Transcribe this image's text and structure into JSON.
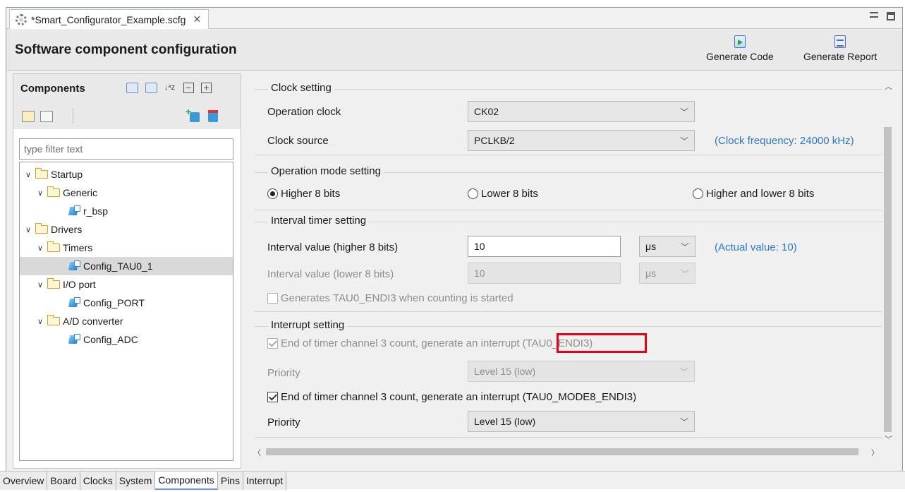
{
  "editor_tab": {
    "title": "*Smart_Configurator_Example.scfg",
    "close": "✕"
  },
  "header": {
    "title": "Software component configuration",
    "generate_code": "Generate Code",
    "generate_report": "Generate Report"
  },
  "components": {
    "title": "Components",
    "filter_placeholder": "type filter text",
    "tree": [
      {
        "label": "Startup",
        "kind": "folder",
        "level": 0
      },
      {
        "label": "Generic",
        "kind": "folder",
        "level": 1
      },
      {
        "label": "r_bsp",
        "kind": "component",
        "level": 2
      },
      {
        "label": "Drivers",
        "kind": "folder",
        "level": 0
      },
      {
        "label": "Timers",
        "kind": "folder",
        "level": 1
      },
      {
        "label": "Config_TAU0_1",
        "kind": "component",
        "level": 2,
        "selected": true
      },
      {
        "label": "I/O port",
        "kind": "folder",
        "level": 1
      },
      {
        "label": "Config_PORT",
        "kind": "component",
        "level": 2
      },
      {
        "label": "A/D converter",
        "kind": "folder",
        "level": 1
      },
      {
        "label": "Config_ADC",
        "kind": "component",
        "level": 2
      }
    ]
  },
  "clock": {
    "title": "Clock setting",
    "operation_clock_label": "Operation clock",
    "operation_clock_value": "CK02",
    "clock_source_label": "Clock source",
    "clock_source_value": "PCLKB/2",
    "clock_frequency": "(Clock frequency: 24000 kHz)"
  },
  "operation_mode": {
    "title": "Operation mode setting",
    "higher": "Higher 8 bits",
    "lower": "Lower 8 bits",
    "both": "Higher and lower 8 bits",
    "selected": "higher"
  },
  "interval": {
    "title": "Interval timer setting",
    "higher_label": "Interval value (higher 8 bits)",
    "higher_value": "10",
    "higher_unit": "μs",
    "actual_value": "(Actual value: 10)",
    "lower_label": "Interval value (lower 8 bits)",
    "lower_value": "10",
    "lower_unit": "μs",
    "generates_label": "Generates TAU0_ENDI3 when counting is started"
  },
  "interrupt": {
    "title": "Interrupt setting",
    "check1_label": "End of timer channel 3 count, generate an interrupt",
    "check1_code": "(TAU0_ENDI3)",
    "priority1_label": "Priority",
    "priority1_value": "Level 15 (low)",
    "check2_label": "End of timer channel 3 count, generate an interrupt (TAU0_MODE8_ENDI3)",
    "priority2_label": "Priority",
    "priority2_value": "Level 15 (low)"
  },
  "bottom_tabs": [
    "Overview",
    "Board",
    "Clocks",
    "System",
    "Components",
    "Pins",
    "Interrupt"
  ],
  "active_bottom_tab": "Components",
  "colors": {
    "highlight": "#e50012",
    "info_text": "#2e78c7"
  }
}
